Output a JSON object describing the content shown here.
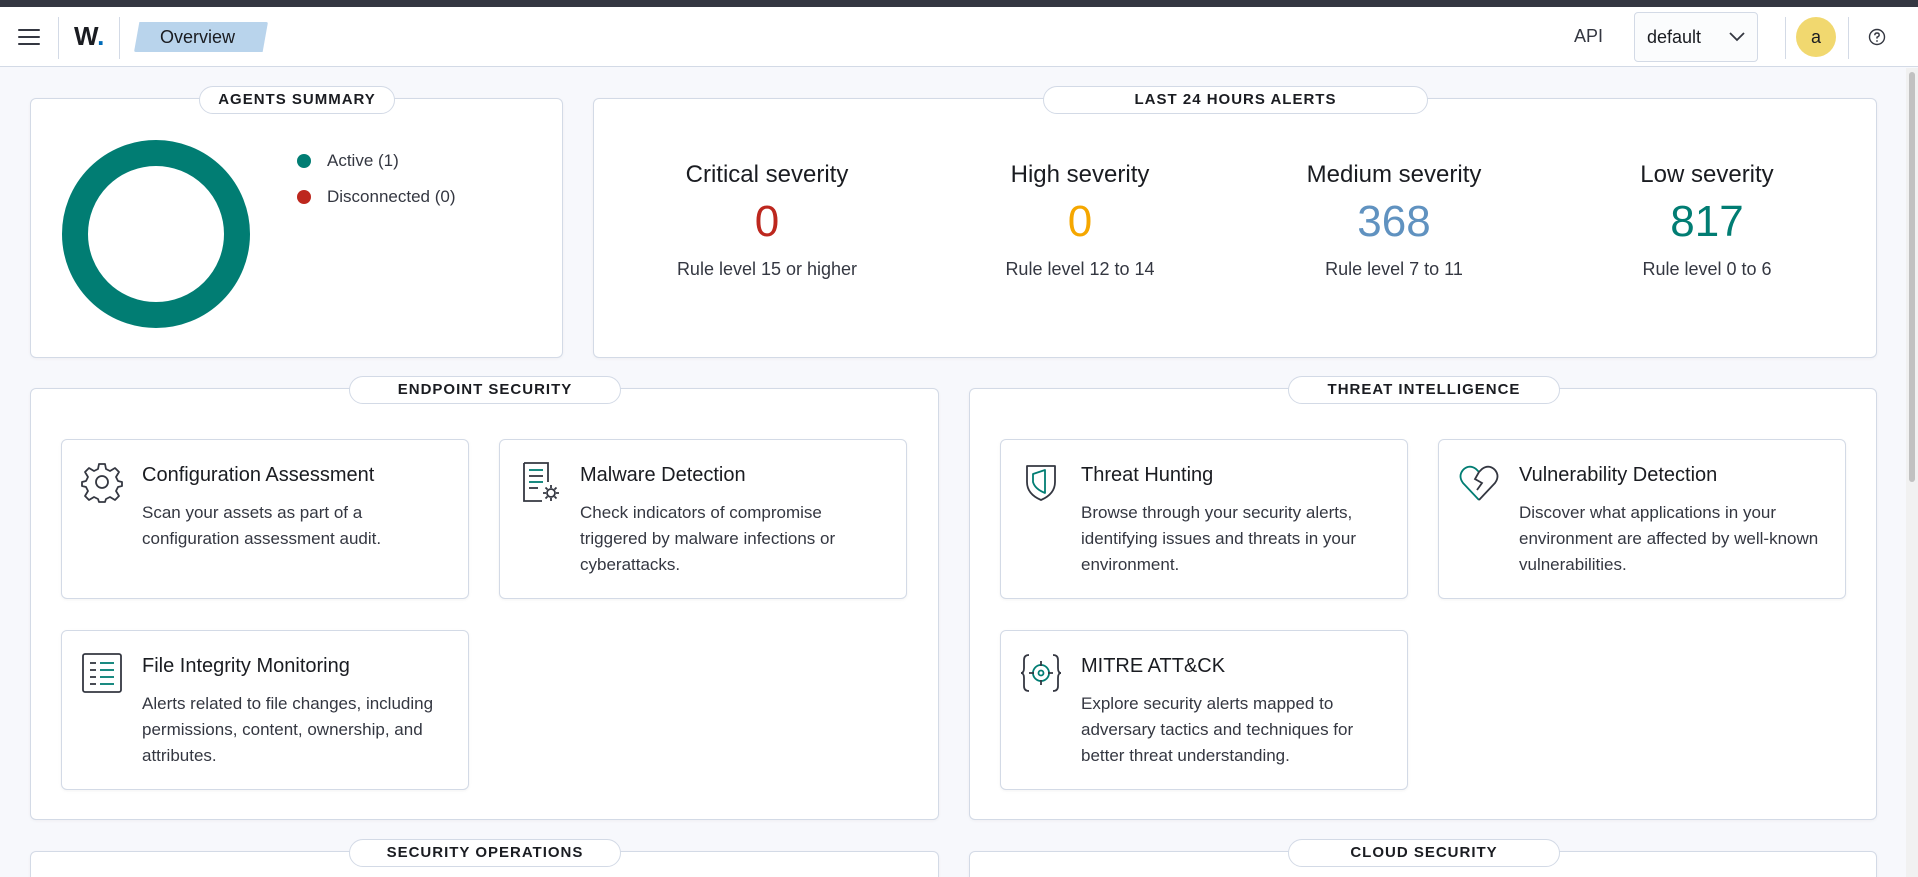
{
  "header": {
    "logo_letter": "W",
    "logo_dot": ".",
    "breadcrumb": "Overview",
    "api_label": "API",
    "api_select_value": "default",
    "avatar_initial": "a"
  },
  "colors": {
    "teal": "#017d73",
    "critical": "#bd271e",
    "high": "#f5a700",
    "medium": "#6092c0",
    "low": "#017d73",
    "disconnected": "#bd271e"
  },
  "agents_summary": {
    "title": "AGENTS SUMMARY",
    "legend": [
      {
        "label": "Active (1)",
        "value": 1
      },
      {
        "label": "Disconnected (0)",
        "value": 0
      }
    ]
  },
  "alerts": {
    "title": "LAST 24 HOURS ALERTS",
    "items": [
      {
        "label": "Critical severity",
        "count": "0",
        "sub": "Rule level 15 or higher"
      },
      {
        "label": "High severity",
        "count": "0",
        "sub": "Rule level 12 to 14"
      },
      {
        "label": "Medium severity",
        "count": "368",
        "sub": "Rule level 7 to 11"
      },
      {
        "label": "Low severity",
        "count": "817",
        "sub": "Rule level 0 to 6"
      }
    ]
  },
  "endpoint_security": {
    "title": "ENDPOINT SECURITY",
    "cards": [
      {
        "title": "Configuration Assessment",
        "desc": "Scan your assets as part of a configuration assessment audit.",
        "icon": "gear-icon"
      },
      {
        "title": "Malware Detection",
        "desc": "Check indicators of compromise triggered by malware infections or cyberattacks.",
        "icon": "malware-document-icon"
      },
      {
        "title": "File Integrity Monitoring",
        "desc": "Alerts related to file changes, including permissions, content, ownership, and attributes.",
        "icon": "file-list-icon"
      }
    ]
  },
  "threat_intelligence": {
    "title": "THREAT INTELLIGENCE",
    "cards": [
      {
        "title": "Threat Hunting",
        "desc": "Browse through your security alerts, identifying issues and threats in your environment.",
        "icon": "shield-icon"
      },
      {
        "title": "Vulnerability Detection",
        "desc": "Discover what applications in your environment are affected by well-known vulnerabilities.",
        "icon": "broken-heart-icon"
      },
      {
        "title": "MITRE ATT&CK",
        "desc": "Explore security alerts mapped to adversary tactics and techniques for better threat understanding.",
        "icon": "crosshair-braces-icon"
      }
    ]
  },
  "security_operations": {
    "title": "SECURITY OPERATIONS"
  },
  "cloud_security": {
    "title": "CLOUD SECURITY"
  }
}
